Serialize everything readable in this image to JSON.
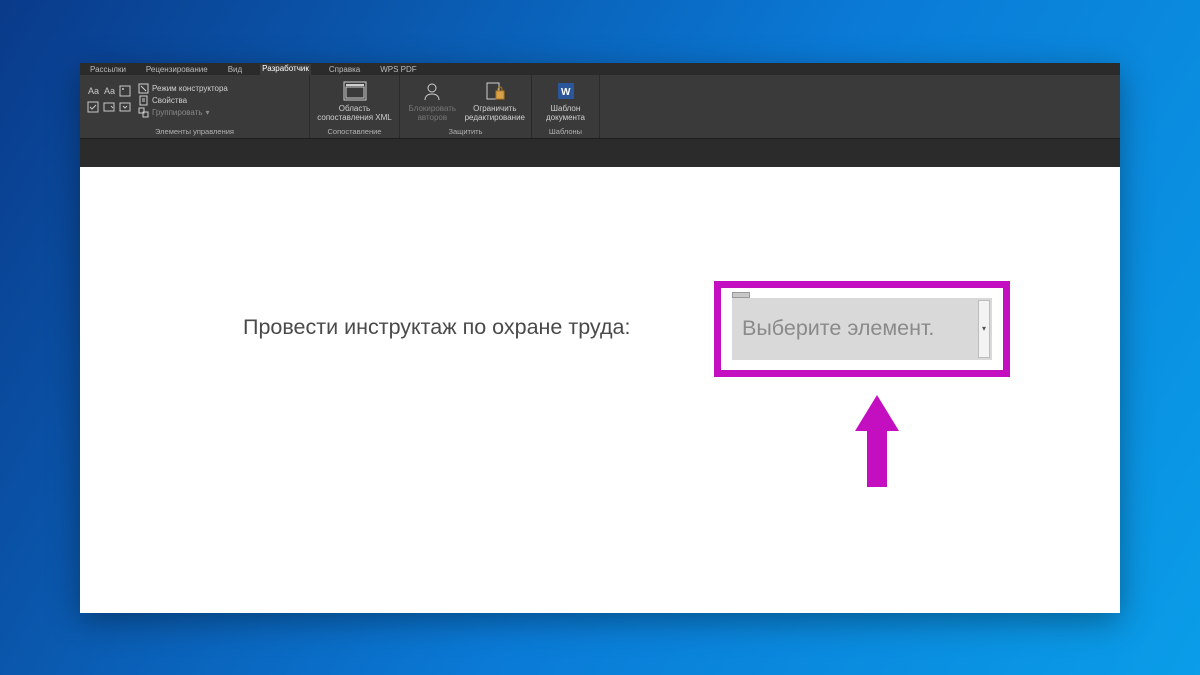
{
  "tabs": {
    "mailings": "Рассылки",
    "review": "Рецензирование",
    "view": "Вид",
    "developer": "Разработчик",
    "help": "Справка",
    "wpspdf": "WPS PDF"
  },
  "ribbon": {
    "controls_group": {
      "design_mode": "Режим конструктора",
      "properties": "Свойства",
      "group": "Группировать",
      "title": "Элементы управления"
    },
    "mapping_group": {
      "button": "Область сопоставления XML",
      "title": "Сопоставление"
    },
    "protect_group": {
      "block_authors": "Блокировать авторов",
      "restrict": "Ограничить редактирование",
      "title": "Защитить"
    },
    "templates_group": {
      "button": "Шаблон документа",
      "title": "Шаблоны"
    }
  },
  "document": {
    "line_text": "Провести инструктаж по охране труда:",
    "dropdown_placeholder": "Выберите элемент."
  },
  "colors": {
    "accent_magenta": "#c40fc1"
  }
}
